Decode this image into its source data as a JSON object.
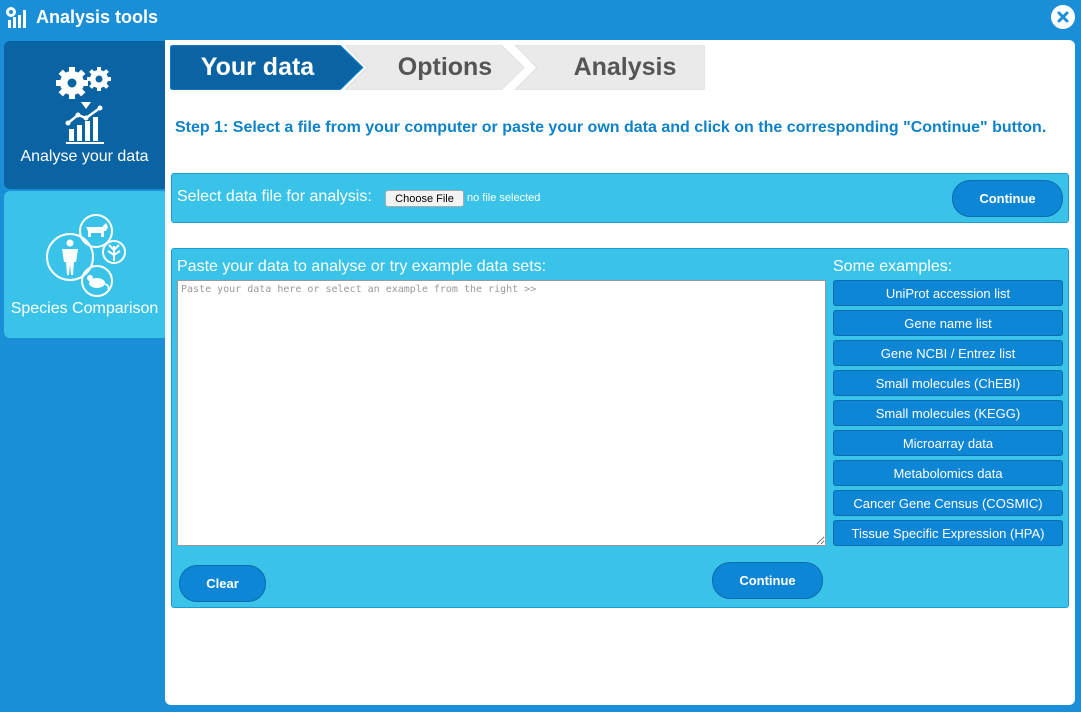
{
  "app": {
    "title": "Analysis tools"
  },
  "sidebar": {
    "items": [
      {
        "label": "Analyse your data"
      },
      {
        "label": "Species Comparison"
      }
    ]
  },
  "steps": [
    {
      "label": "Your data",
      "active": true
    },
    {
      "label": "Options",
      "active": false
    },
    {
      "label": "Analysis",
      "active": false
    }
  ],
  "instructions": "Step 1: Select a file from your computer or paste your own data and click on the corresponding \"Continue\" button.",
  "file_panel": {
    "label": "Select data file for analysis:",
    "choose_button": "Choose File",
    "file_status": "no file selected",
    "continue_label": "Continue"
  },
  "paste_panel": {
    "label": "Paste your data to analyse or try example data sets:",
    "placeholder": "Paste your data here or select an example from the right >>",
    "clear_label": "Clear",
    "continue_label": "Continue"
  },
  "examples": {
    "label": "Some examples:",
    "items": [
      "UniProt accession list",
      "Gene name list",
      "Gene NCBI / Entrez list",
      "Small molecules (ChEBI)",
      "Small molecules (KEGG)",
      "Microarray data",
      "Metabolomics data",
      "Cancer Gene Census (COSMIC)",
      "Tissue Specific Expression (HPA)"
    ]
  },
  "colors": {
    "frame": "#1a8fd8",
    "active_tab": "#0a63a2",
    "panel": "#39c3e8",
    "button": "#0e86d6",
    "instruction_text": "#0e82c8"
  },
  "icons": {
    "title": "analysis-chart-gear-icon",
    "close": "close-x-icon",
    "analyse": "gears-chart-icon",
    "species": "human-animals-icon"
  }
}
